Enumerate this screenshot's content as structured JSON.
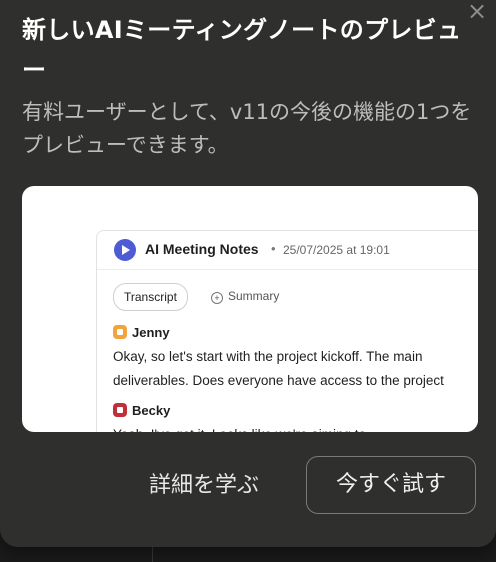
{
  "dialog": {
    "title": "新しいAIミーティングノートのプレビュー",
    "subtitle": "有料ユーザーとして、v11の今後の機能の1つをプレビューできます。",
    "close_label": "×",
    "learn_more_label": "詳細を学ぶ",
    "try_now_label": "今すぐ試す"
  },
  "preview": {
    "title": "AI Meeting Notes",
    "separator": "•",
    "date": "25/07/2025 at 19:01",
    "tabs": [
      "Transcript",
      "Summary"
    ],
    "summary_plus": "+",
    "speakers": [
      {
        "name": "Jenny",
        "color": "#f2a43a",
        "text_lines": [
          "Okay, so let's start with the project kickoff. The main",
          "deliverables. Does everyone have access to the project"
        ]
      },
      {
        "name": "Becky",
        "color": "#c0303a",
        "text_lines": [
          "Yeah, I've got it. Looks like we're aiming to"
        ]
      }
    ]
  },
  "colors": {
    "dialog_bg": "#2f2f2d",
    "accent": "#4f5bd5"
  }
}
